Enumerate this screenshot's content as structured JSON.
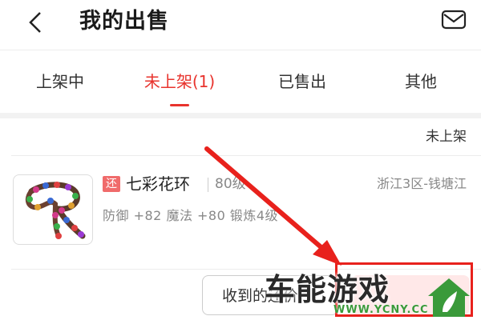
{
  "header": {
    "title": "我的出售",
    "back_icon": "chevron-left-icon",
    "mail_icon": "mail-icon"
  },
  "tabs": [
    {
      "label": "上架中",
      "active": false
    },
    {
      "label": "未上架(1)",
      "active": true
    },
    {
      "label": "已售出",
      "active": false
    },
    {
      "label": "其他",
      "active": false
    }
  ],
  "section": {
    "status": "未上架"
  },
  "item": {
    "badge": "还",
    "name": "七彩花环",
    "level": "80级",
    "server": "浙江3区-钱塘江",
    "stats": "防御 +82 魔法 +80 锻炼4级"
  },
  "actions": {
    "received_label": "收到的还价"
  },
  "watermark": {
    "brand": "车能游戏",
    "url": "WWW.YCNY.CC"
  },
  "colors": {
    "accent": "#e8332d",
    "badge": "#f06b6b",
    "annotation": "#e8211c"
  }
}
